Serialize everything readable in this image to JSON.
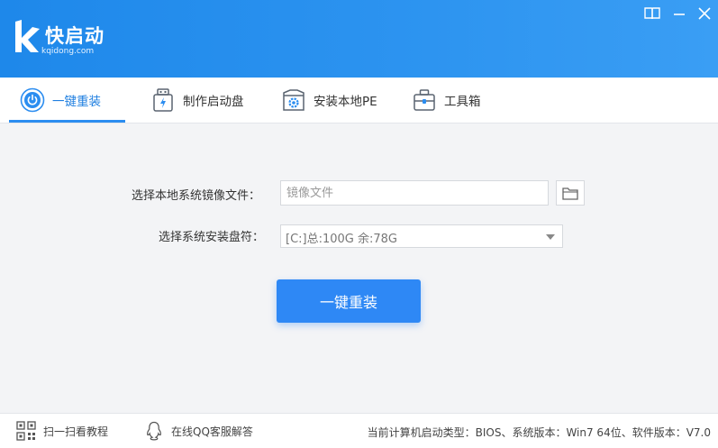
{
  "app": {
    "logo_text": "快启动",
    "logo_domain": "kqidong.com",
    "accent_color": "#2e88f5"
  },
  "window_controls": [
    {
      "icon": "book-icon"
    },
    {
      "icon": "minimize-icon"
    },
    {
      "icon": "close-icon"
    }
  ],
  "tabs": [
    {
      "label": "一键重装",
      "icon": "power-icon",
      "active": true
    },
    {
      "label": "制作启动盘",
      "icon": "usb-drive-icon",
      "active": false
    },
    {
      "label": "安装本地PE",
      "icon": "box-gear-icon",
      "active": false
    },
    {
      "label": "工具箱",
      "icon": "toolbox-icon",
      "active": false
    }
  ],
  "form": {
    "image_label": "选择本地系统镜像文件：",
    "image_placeholder": "镜像文件",
    "image_value": "",
    "browse_icon": "folder-icon",
    "drive_label": "选择系统安装盘符：",
    "drive_value": "[C:]总:100G 余:78G"
  },
  "primary_button": {
    "label": "一键重装"
  },
  "footer": {
    "scan_label": "扫一扫看教程",
    "qq_label": "在线QQ客服解答",
    "info": "当前计算机启动类型：BIOS、系统版本：Win7 64位、软件版本：V7.0"
  }
}
